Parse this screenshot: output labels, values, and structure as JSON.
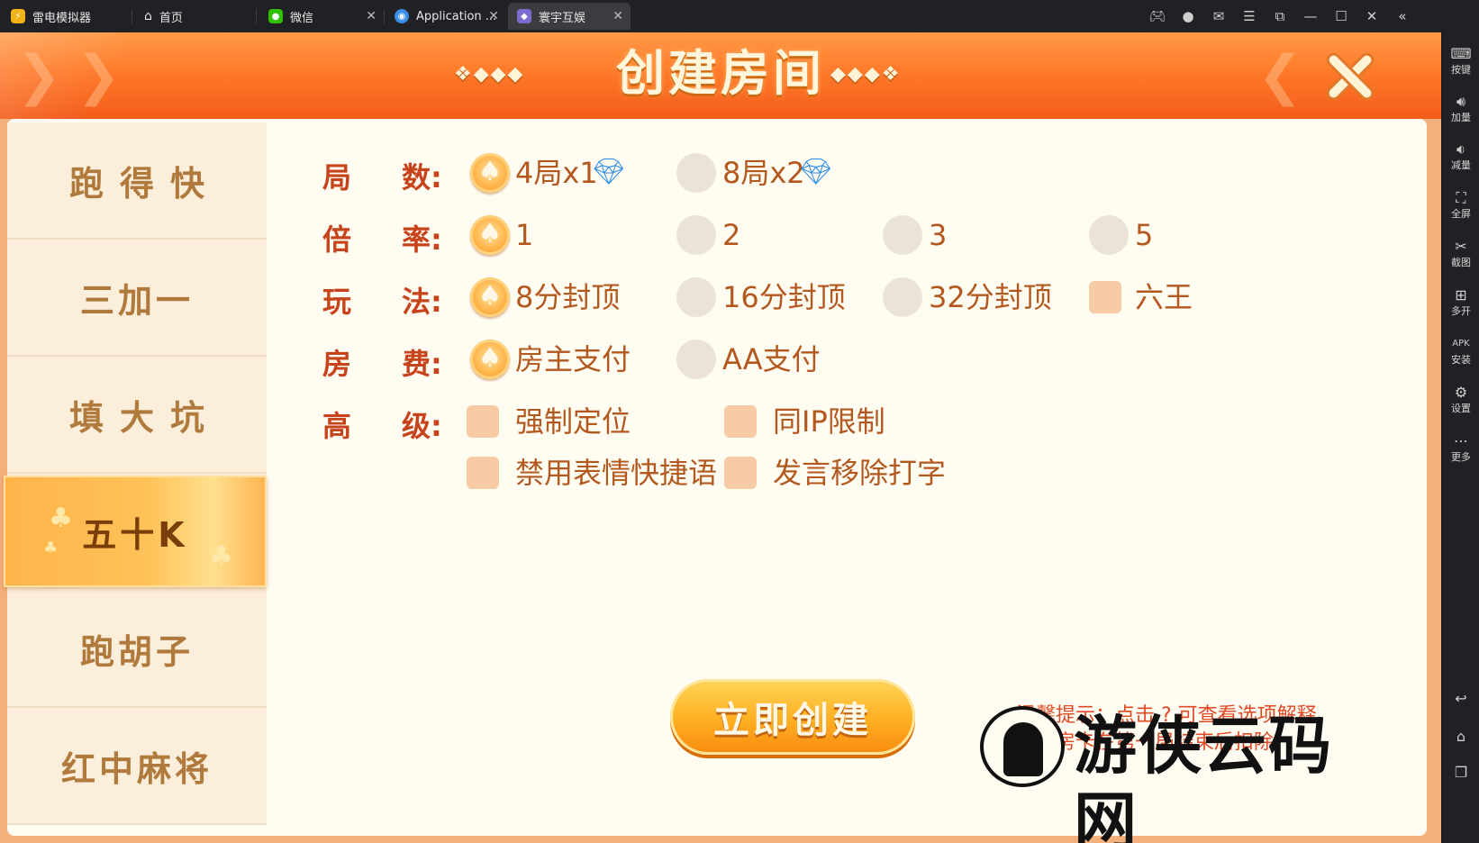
{
  "tabs": [
    {
      "label": "雷电模拟器"
    },
    {
      "label": "首页"
    },
    {
      "label": "微信"
    },
    {
      "label": "Application ..."
    },
    {
      "label": "寰宇互娱"
    }
  ],
  "sidebar": [
    {
      "label": "按键"
    },
    {
      "label": "加量"
    },
    {
      "label": "减量"
    },
    {
      "label": "全屏"
    },
    {
      "label": "截图"
    },
    {
      "label": "多开"
    },
    {
      "label": "安装"
    },
    {
      "label": "设置"
    },
    {
      "label": "更多"
    }
  ],
  "game": {
    "title": "创建房间",
    "menu": [
      {
        "label": "跑得快",
        "active": false
      },
      {
        "label": "三加一",
        "active": false
      },
      {
        "label": "填大坑",
        "active": false
      },
      {
        "label": "五十K",
        "active": true
      },
      {
        "label": "跑胡子",
        "active": false
      },
      {
        "label": "红中麻将",
        "active": false
      }
    ],
    "rows": {
      "rounds": {
        "label_a": "局",
        "label_b": "数:",
        "opt1": "4局x1",
        "opt2": "8局x2"
      },
      "rate": {
        "label_a": "倍",
        "label_b": "率:",
        "opt1": "1",
        "opt2": "2",
        "opt3": "3",
        "opt4": "5"
      },
      "play": {
        "label_a": "玩",
        "label_b": "法:",
        "opt1": "8分封顶",
        "opt2": "16分封顶",
        "opt3": "32分封顶",
        "opt4": "六王"
      },
      "fee": {
        "label_a": "房",
        "label_b": "费:",
        "opt1": "房主支付",
        "opt2": "AA支付"
      },
      "advanced": {
        "label_a": "高",
        "label_b": "级:",
        "opt1": "强制定位",
        "opt2": "同IP限制",
        "opt3": "禁用表情快捷语",
        "opt4": "发言移除打字"
      }
    },
    "create_button": "立即创建",
    "tip_line1": "温馨提示：点击 ? 可查看选项解释",
    "tip_line2": "注：房卡在第一局结束后扣除"
  },
  "watermark": "游侠云码网",
  "colors": {
    "header": "#ff7a2a",
    "label": "#c6431c",
    "option_text": "#b3581e",
    "accent": "#ffb448"
  }
}
